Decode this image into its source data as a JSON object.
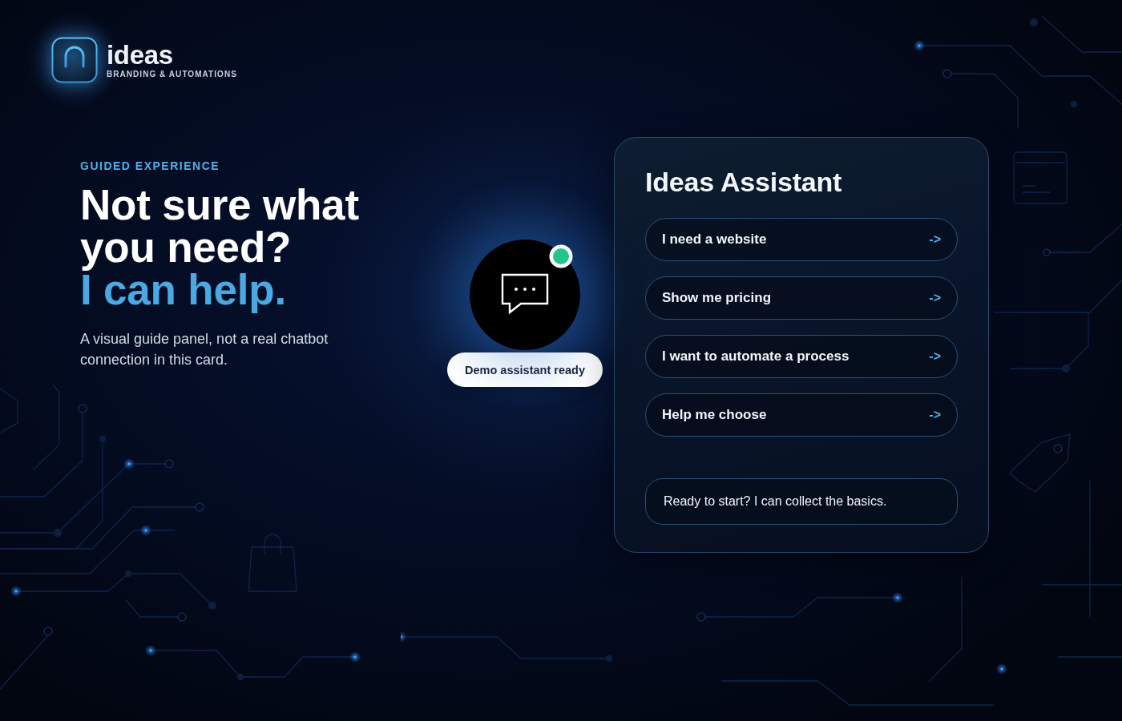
{
  "brand": {
    "name": "ideas",
    "tagline": "BRANDING & AUTOMATIONS"
  },
  "hero": {
    "eyebrow": "GUIDED EXPERIENCE",
    "headline": "Not sure what you need?",
    "highlight": "I can help.",
    "description": "A visual guide panel, not a real chatbot connection in this card."
  },
  "assistant_badge": {
    "online": true,
    "status": "Demo assistant ready"
  },
  "assistant_panel": {
    "title": "Ideas Assistant",
    "options": [
      {
        "label": "I need a website",
        "arrow": "->"
      },
      {
        "label": "Show me pricing",
        "arrow": "->"
      },
      {
        "label": "I want to automate a process",
        "arrow": "->"
      },
      {
        "label": "Help me choose",
        "arrow": "->"
      }
    ],
    "message": "Ready to start? I can collect the basics."
  }
}
